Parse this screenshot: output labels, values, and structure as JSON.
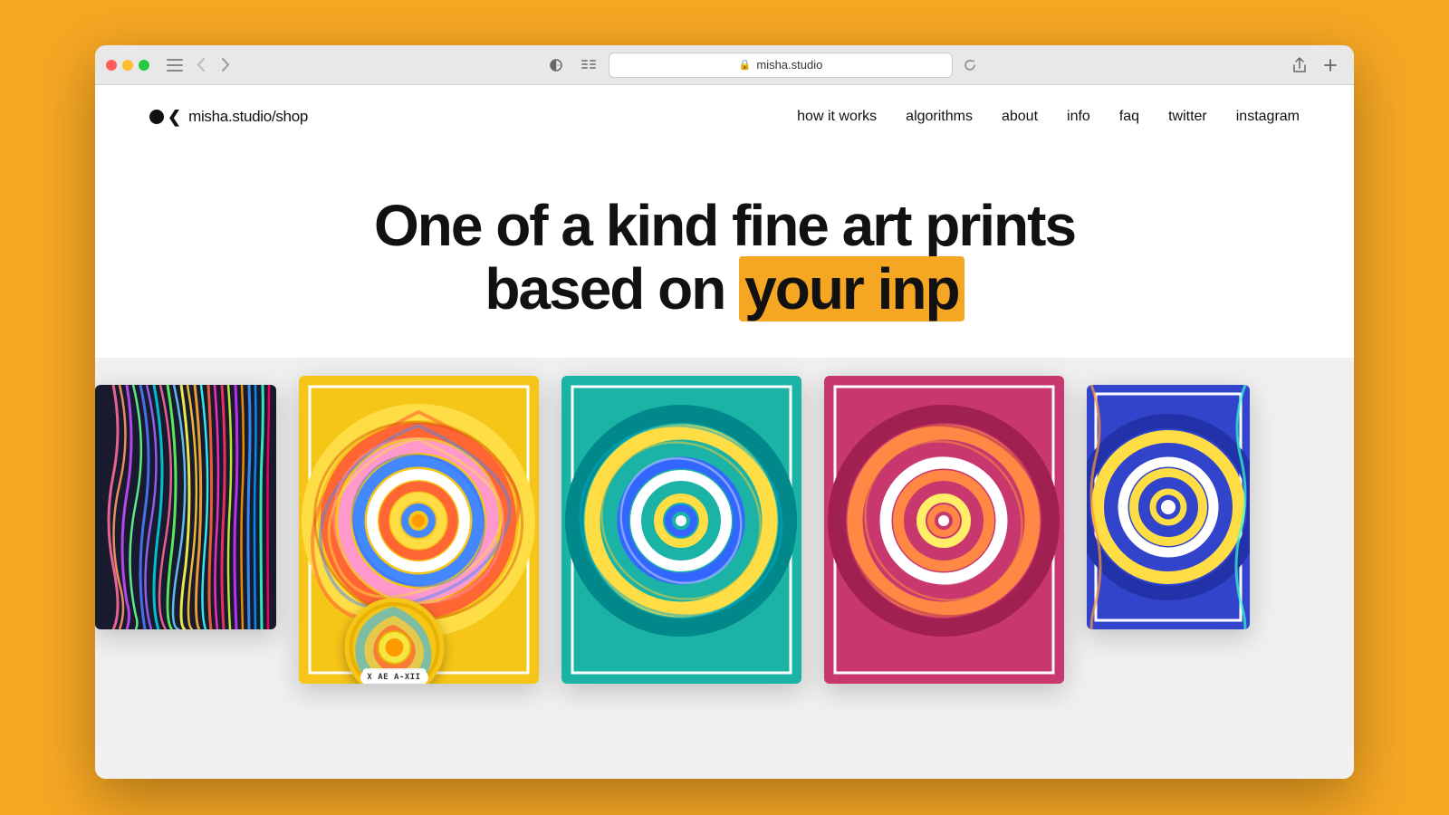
{
  "browser": {
    "url": "misha.studio",
    "tab_label": "misha.studio"
  },
  "site": {
    "logo_text": "misha.studio",
    "logo_subpath": "/shop",
    "nav_items": [
      {
        "label": "how it works",
        "href": "#"
      },
      {
        "label": "algorithms",
        "href": "#"
      },
      {
        "label": "about",
        "href": "#"
      },
      {
        "label": "info",
        "href": "#"
      },
      {
        "label": "faq",
        "href": "#"
      },
      {
        "label": "twitter",
        "href": "#"
      },
      {
        "label": "instagram",
        "href": "#"
      }
    ],
    "hero_title_line1": "One of a kind fine art prints",
    "hero_title_line2_before": "based on ",
    "hero_title_line2_highlight": "your inp",
    "coin_badge_label": "X AE A-XII"
  }
}
